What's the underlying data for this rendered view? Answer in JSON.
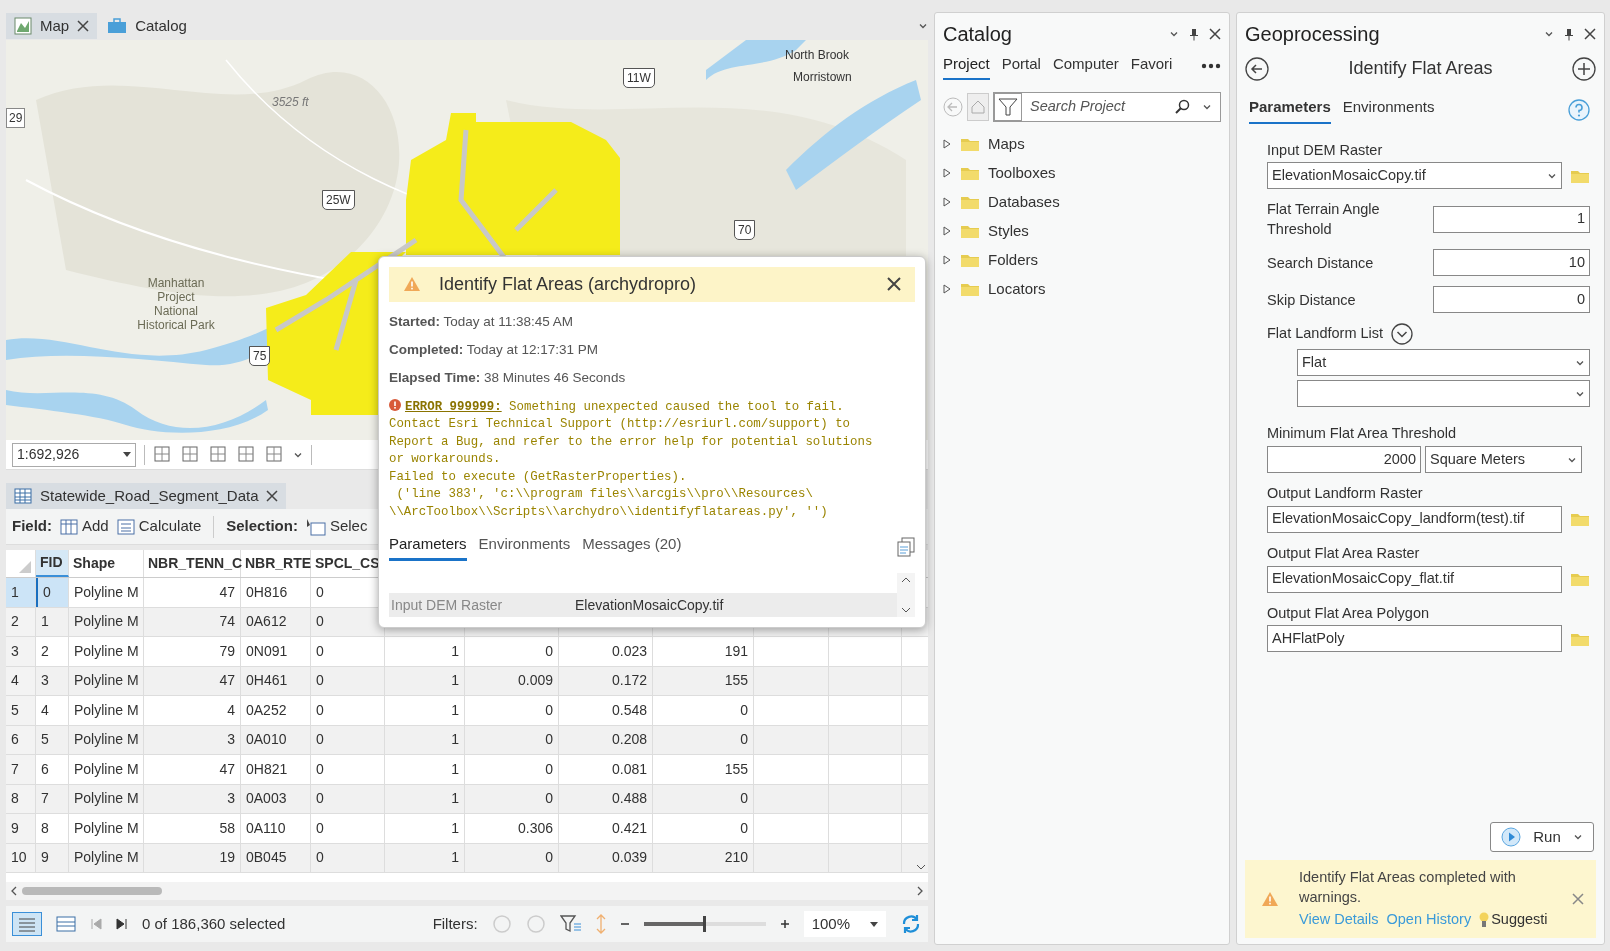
{
  "map_view": {
    "tabs": [
      {
        "label": "Map",
        "selected": true
      },
      {
        "label": "Catalog",
        "selected": false
      }
    ],
    "labels": [
      {
        "kind": "place",
        "text": "North Brook"
      },
      {
        "kind": "place",
        "text": "Morristown"
      },
      {
        "kind": "elevation",
        "text": "3525 ft"
      },
      {
        "kind": "edge",
        "text": "29"
      },
      {
        "kind": "shield",
        "text": "11W"
      },
      {
        "kind": "shield",
        "text": "25W"
      },
      {
        "kind": "shield",
        "text": "70"
      },
      {
        "kind": "shield",
        "text": "75"
      },
      {
        "kind": "park",
        "text": "Manhattan Project National Historical Park"
      }
    ],
    "scale": "1:692,926"
  },
  "popup": {
    "title": "Identify Flat Areas (archydropro)",
    "info": [
      "**Started:** Today at 11:38:45 AM",
      "**Completed:** Today at 12:17:31 PM",
      "**Elapsed Time:** 38 Minutes 46 Seconds"
    ],
    "error_code": "ERROR 999999:",
    "error_message": " Something unexpected caused the tool to fail.\nContact Esri Technical Support (http://esriurl.com/support) to\nReport a Bug, and refer to the error help for potential solutions\nor workarounds.\nFailed to execute (GetRasterProperties).\n ('line 383', 'c:\\\\program files\\\\arcgis\\\\pro\\\\Resources\\\n\\\\ArcToolbox\\\\Scripts\\\\archydro\\\\identifyflatareas.py', '')",
    "tabs": [
      {
        "label": "Parameters",
        "selected": true
      },
      {
        "label": "Environments",
        "selected": false
      },
      {
        "label": "Messages (20)",
        "selected": false
      }
    ],
    "parameters": [
      {
        "name": "Input DEM Raster",
        "value": "ElevationMosaicCopy.tif"
      }
    ]
  },
  "attribute_table": {
    "tab": "Statewide_Road_Segment_Data",
    "field_label": "Field:",
    "add": "Add",
    "calculate": "Calculate",
    "selection_label": "Selection:",
    "select": "Selec",
    "columns": [
      {
        "label": "FID",
        "selected": true
      },
      {
        "label": "Shape",
        "selected": false
      },
      {
        "label": "NBR_TENN_C",
        "selected": false
      },
      {
        "label": "NBR_RTE",
        "selected": false
      },
      {
        "label": "SPCL_CS",
        "selected": false
      }
    ],
    "rows": [
      {
        "number": "1",
        "selected": true,
        "cells": [
          "0",
          "Polyline M",
          "47",
          "0H816",
          "0"
        ]
      },
      {
        "number": "2",
        "selected": false,
        "cells": [
          "1",
          "Polyline M",
          "74",
          "0A612",
          "0"
        ]
      },
      {
        "number": "3",
        "selected": false,
        "cells": [
          "2",
          "Polyline M",
          "79",
          "0N091",
          "0",
          "1",
          "0",
          "0.023",
          "191"
        ]
      },
      {
        "number": "4",
        "selected": false,
        "cells": [
          "3",
          "Polyline M",
          "47",
          "0H461",
          "0",
          "1",
          "0.009",
          "0.172",
          "155"
        ]
      },
      {
        "number": "5",
        "selected": false,
        "cells": [
          "4",
          "Polyline M",
          "4",
          "0A252",
          "0",
          "1",
          "0",
          "0.548",
          "0"
        ]
      },
      {
        "number": "6",
        "selected": false,
        "cells": [
          "5",
          "Polyline M",
          "3",
          "0A010",
          "0",
          "1",
          "0",
          "0.208",
          "0"
        ]
      },
      {
        "number": "7",
        "selected": false,
        "cells": [
          "6",
          "Polyline M",
          "47",
          "0H821",
          "0",
          "1",
          "0",
          "0.081",
          "155"
        ]
      },
      {
        "number": "8",
        "selected": false,
        "cells": [
          "7",
          "Polyline M",
          "3",
          "0A003",
          "0",
          "1",
          "0",
          "0.488",
          "0"
        ]
      },
      {
        "number": "9",
        "selected": false,
        "cells": [
          "8",
          "Polyline M",
          "58",
          "0A110",
          "0",
          "1",
          "0.306",
          "0.421",
          "0"
        ]
      },
      {
        "number": "10",
        "selected": false,
        "cells": [
          "9",
          "Polyline M",
          "19",
          "0B045",
          "0",
          "1",
          "0",
          "0.039",
          "210"
        ]
      }
    ],
    "status": "0 of 186,360 selected",
    "filters_label": "Filters:",
    "zoom_slider": {
      "level": 0.5
    },
    "zoom": "100%"
  },
  "catalog_pane": {
    "title": "Catalog",
    "tabs": [
      {
        "label": "Project",
        "selected": true
      },
      {
        "label": "Portal",
        "selected": false
      },
      {
        "label": "Computer",
        "selected": false
      },
      {
        "label": "Favori",
        "selected": false
      }
    ],
    "search": {
      "placeholder": "Search Project"
    },
    "items": [
      {
        "label": "Maps",
        "expanded": false
      },
      {
        "label": "Toolboxes",
        "expanded": false
      },
      {
        "label": "Databases",
        "expanded": false
      },
      {
        "label": "Styles",
        "expanded": false
      },
      {
        "label": "Folders",
        "expanded": false
      },
      {
        "label": "Locators",
        "expanded": false
      }
    ]
  },
  "geoprocessing_pane": {
    "title": "Geoprocessing",
    "tool": "Identify Flat Areas",
    "tabs": [
      {
        "label": "Parameters",
        "selected": true
      },
      {
        "label": "Environments",
        "selected": false
      }
    ],
    "parameters": [
      {
        "kind": "dataset",
        "label": "Input DEM Raster",
        "value": "ElevationMosaicCopy.tif",
        "dropdown": true
      },
      {
        "kind": "number",
        "label": "Flat Terrain Angle Threshold",
        "value": "1"
      },
      {
        "kind": "number",
        "label": "Search Distance",
        "value": "10"
      },
      {
        "kind": "number",
        "label": "Skip Distance",
        "value": "0"
      },
      {
        "kind": "list",
        "label": "Flat Landform List",
        "values": [
          "Flat"
        ]
      },
      {
        "kind": "unit",
        "label": "Minimum Flat Area Threshold",
        "value": "2000",
        "unit": "Square Meters"
      },
      {
        "kind": "dataset",
        "label": "Output Landform Raster",
        "value": "ElevationMosaicCopy_landform(test).tif",
        "dropdown": false
      },
      {
        "kind": "dataset",
        "label": "Output Flat Area Raster",
        "value": "ElevationMosaicCopy_flat.tif",
        "dropdown": false
      },
      {
        "kind": "dataset",
        "label": "Output Flat Area Polygon",
        "value": "AHFlatPoly",
        "dropdown": false
      }
    ],
    "run": "Run",
    "notification": {
      "message": "Identify Flat Areas completed with warnings.",
      "links": [
        "View Details",
        "Open History"
      ],
      "suggestion": "Suggesti"
    }
  }
}
